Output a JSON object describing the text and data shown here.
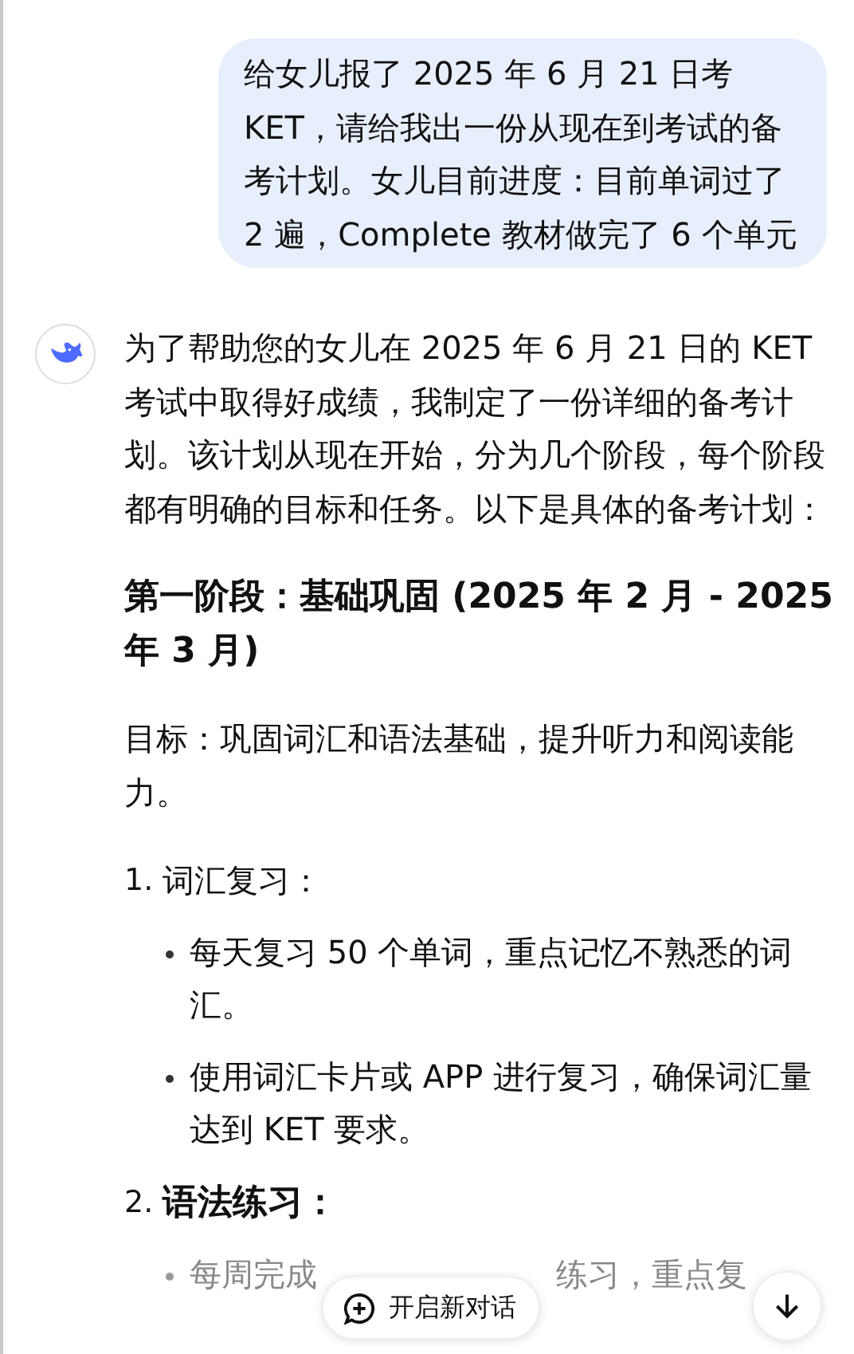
{
  "user_message": {
    "text": "给女儿报了 2025 年 6 月 21 日考 KET，请给我出一份从现在到考试的备考计划。女儿目前进度：目前单词过了 2 遍，Complete 教材做完了 6 个单元"
  },
  "assistant_blocks": [
    {
      "kind": "paragraph",
      "text": "为了帮助您的女儿在 2025 年 6 月 21 日的 KET 考试中取得好成绩，我制定了一份详细的备考计划。该计划从现在开始，分为几个阶段，每个阶段都有明确的目标和任务。以下是具体的备考计划："
    },
    {
      "kind": "heading",
      "text": "第一阶段：基础巩固 (2025 年 2 月 - 2025 年 3 月)"
    },
    {
      "kind": "paragraph",
      "text": "目标：巩固词汇和语法基础，提升听力和阅读能力。"
    },
    {
      "kind": "numbered",
      "number": "1.",
      "title": "词汇复习：",
      "bold": false,
      "bullets": [
        "每天复习 50 个单词，重点记忆不熟悉的词汇。",
        "使用词汇卡片或 APP 进行复习，确保词汇量达到 KET 要求。"
      ]
    },
    {
      "kind": "numbered",
      "number": "2.",
      "title": "语法练习：",
      "bold": true
    },
    {
      "kind": "faded_bullet",
      "parts": [
        "每周完成",
        "练习，重点复"
      ]
    }
  ],
  "new_chat_button": {
    "label": "开启新对话"
  }
}
